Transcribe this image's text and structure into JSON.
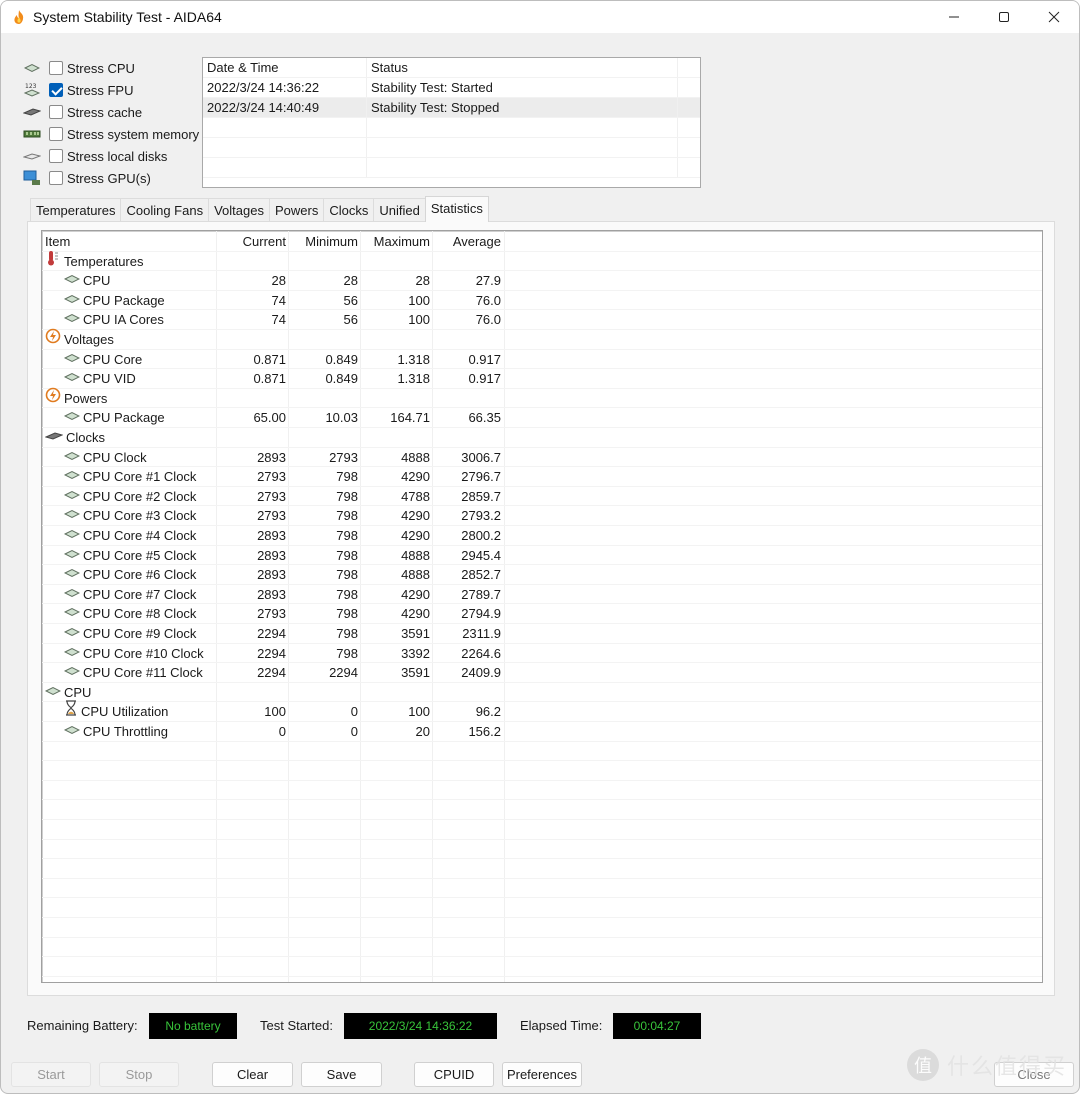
{
  "window": {
    "title": "System Stability Test - AIDA64",
    "controls": {
      "minimize": "—",
      "maximize": "☐",
      "close": "✕"
    }
  },
  "stress_options": [
    {
      "label": "Stress CPU",
      "checked": false,
      "icon": "cpu-chip-icon"
    },
    {
      "label": "Stress FPU",
      "checked": true,
      "icon": "fpu-icon"
    },
    {
      "label": "Stress cache",
      "checked": false,
      "icon": "cache-chip-icon"
    },
    {
      "label": "Stress system memory",
      "checked": false,
      "icon": "memory-module-icon"
    },
    {
      "label": "Stress local disks",
      "checked": false,
      "icon": "disk-drive-icon"
    },
    {
      "label": "Stress GPU(s)",
      "checked": false,
      "icon": "gpu-monitor-icon"
    }
  ],
  "log": {
    "headers": [
      "Date & Time",
      "Status"
    ],
    "rows": [
      {
        "datetime": "2022/3/24 14:36:22",
        "status": "Stability Test: Started",
        "selected": false
      },
      {
        "datetime": "2022/3/24 14:40:49",
        "status": "Stability Test: Stopped",
        "selected": true
      }
    ]
  },
  "tabs": [
    {
      "label": "Temperatures",
      "active": false
    },
    {
      "label": "Cooling Fans",
      "active": false
    },
    {
      "label": "Voltages",
      "active": false
    },
    {
      "label": "Powers",
      "active": false
    },
    {
      "label": "Clocks",
      "active": false
    },
    {
      "label": "Unified",
      "active": false
    },
    {
      "label": "Statistics",
      "active": true
    }
  ],
  "statistics": {
    "headers": {
      "item": "Item",
      "current": "Current",
      "minimum": "Minimum",
      "maximum": "Maximum",
      "average": "Average"
    },
    "rows": [
      {
        "type": "group",
        "label": "Temperatures",
        "icon": "thermometer-icon"
      },
      {
        "type": "item",
        "label": "CPU",
        "icon": "cpu-chip-icon",
        "current": "28",
        "minimum": "28",
        "maximum": "28",
        "average": "27.9"
      },
      {
        "type": "item",
        "label": "CPU Package",
        "icon": "cpu-chip-icon",
        "current": "74",
        "minimum": "56",
        "maximum": "100",
        "average": "76.0"
      },
      {
        "type": "item",
        "label": "CPU IA Cores",
        "icon": "cpu-chip-icon",
        "current": "74",
        "minimum": "56",
        "maximum": "100",
        "average": "76.0"
      },
      {
        "type": "group",
        "label": "Voltages",
        "icon": "lightning-icon"
      },
      {
        "type": "item",
        "label": "CPU Core",
        "icon": "cpu-chip-icon",
        "current": "0.871",
        "minimum": "0.849",
        "maximum": "1.318",
        "average": "0.917"
      },
      {
        "type": "item",
        "label": "CPU VID",
        "icon": "cpu-chip-icon",
        "current": "0.871",
        "minimum": "0.849",
        "maximum": "1.318",
        "average": "0.917"
      },
      {
        "type": "group",
        "label": "Powers",
        "icon": "lightning-icon"
      },
      {
        "type": "item",
        "label": "CPU Package",
        "icon": "cpu-chip-icon",
        "current": "65.00",
        "minimum": "10.03",
        "maximum": "164.71",
        "average": "66.35"
      },
      {
        "type": "group",
        "label": "Clocks",
        "icon": "clock-chip-icon"
      },
      {
        "type": "item",
        "label": "CPU Clock",
        "icon": "cpu-chip-icon",
        "current": "2893",
        "minimum": "2793",
        "maximum": "4888",
        "average": "3006.7"
      },
      {
        "type": "item",
        "label": "CPU Core #1 Clock",
        "icon": "cpu-chip-icon",
        "current": "2793",
        "minimum": "798",
        "maximum": "4290",
        "average": "2796.7"
      },
      {
        "type": "item",
        "label": "CPU Core #2 Clock",
        "icon": "cpu-chip-icon",
        "current": "2793",
        "minimum": "798",
        "maximum": "4788",
        "average": "2859.7"
      },
      {
        "type": "item",
        "label": "CPU Core #3 Clock",
        "icon": "cpu-chip-icon",
        "current": "2793",
        "minimum": "798",
        "maximum": "4290",
        "average": "2793.2"
      },
      {
        "type": "item",
        "label": "CPU Core #4 Clock",
        "icon": "cpu-chip-icon",
        "current": "2893",
        "minimum": "798",
        "maximum": "4290",
        "average": "2800.2"
      },
      {
        "type": "item",
        "label": "CPU Core #5 Clock",
        "icon": "cpu-chip-icon",
        "current": "2893",
        "minimum": "798",
        "maximum": "4888",
        "average": "2945.4"
      },
      {
        "type": "item",
        "label": "CPU Core #6 Clock",
        "icon": "cpu-chip-icon",
        "current": "2893",
        "minimum": "798",
        "maximum": "4888",
        "average": "2852.7"
      },
      {
        "type": "item",
        "label": "CPU Core #7 Clock",
        "icon": "cpu-chip-icon",
        "current": "2893",
        "minimum": "798",
        "maximum": "4290",
        "average": "2789.7"
      },
      {
        "type": "item",
        "label": "CPU Core #8 Clock",
        "icon": "cpu-chip-icon",
        "current": "2793",
        "minimum": "798",
        "maximum": "4290",
        "average": "2794.9"
      },
      {
        "type": "item",
        "label": "CPU Core #9 Clock",
        "icon": "cpu-chip-icon",
        "current": "2294",
        "minimum": "798",
        "maximum": "3591",
        "average": "2311.9"
      },
      {
        "type": "item",
        "label": "CPU Core #10 Clock",
        "icon": "cpu-chip-icon",
        "current": "2294",
        "minimum": "798",
        "maximum": "3392",
        "average": "2264.6"
      },
      {
        "type": "item",
        "label": "CPU Core #11 Clock",
        "icon": "cpu-chip-icon",
        "current": "2294",
        "minimum": "2294",
        "maximum": "3591",
        "average": "2409.9"
      },
      {
        "type": "group",
        "label": "CPU",
        "icon": "cpu-chip-icon"
      },
      {
        "type": "item",
        "label": "CPU Utilization",
        "icon": "hourglass-icon",
        "current": "100",
        "minimum": "0",
        "maximum": "100",
        "average": "96.2"
      },
      {
        "type": "item",
        "label": "CPU Throttling",
        "icon": "cpu-chip-icon",
        "current": "0",
        "minimum": "0",
        "maximum": "20",
        "average": "156.2"
      }
    ]
  },
  "status_bar": {
    "battery_label": "Remaining Battery:",
    "battery_value": "No battery",
    "started_label": "Test Started:",
    "started_value": "2022/3/24 14:36:22",
    "elapsed_label": "Elapsed Time:",
    "elapsed_value": "00:04:27"
  },
  "buttons": {
    "start": "Start",
    "stop": "Stop",
    "clear": "Clear",
    "save": "Save",
    "cpuid": "CPUID",
    "preferences": "Preferences",
    "close": "Close"
  },
  "watermark": {
    "badge": "值",
    "text": "什么值得买"
  },
  "colors": {
    "accent": "#005fb8",
    "status_text": "#38c43a",
    "status_bg": "#000000"
  }
}
